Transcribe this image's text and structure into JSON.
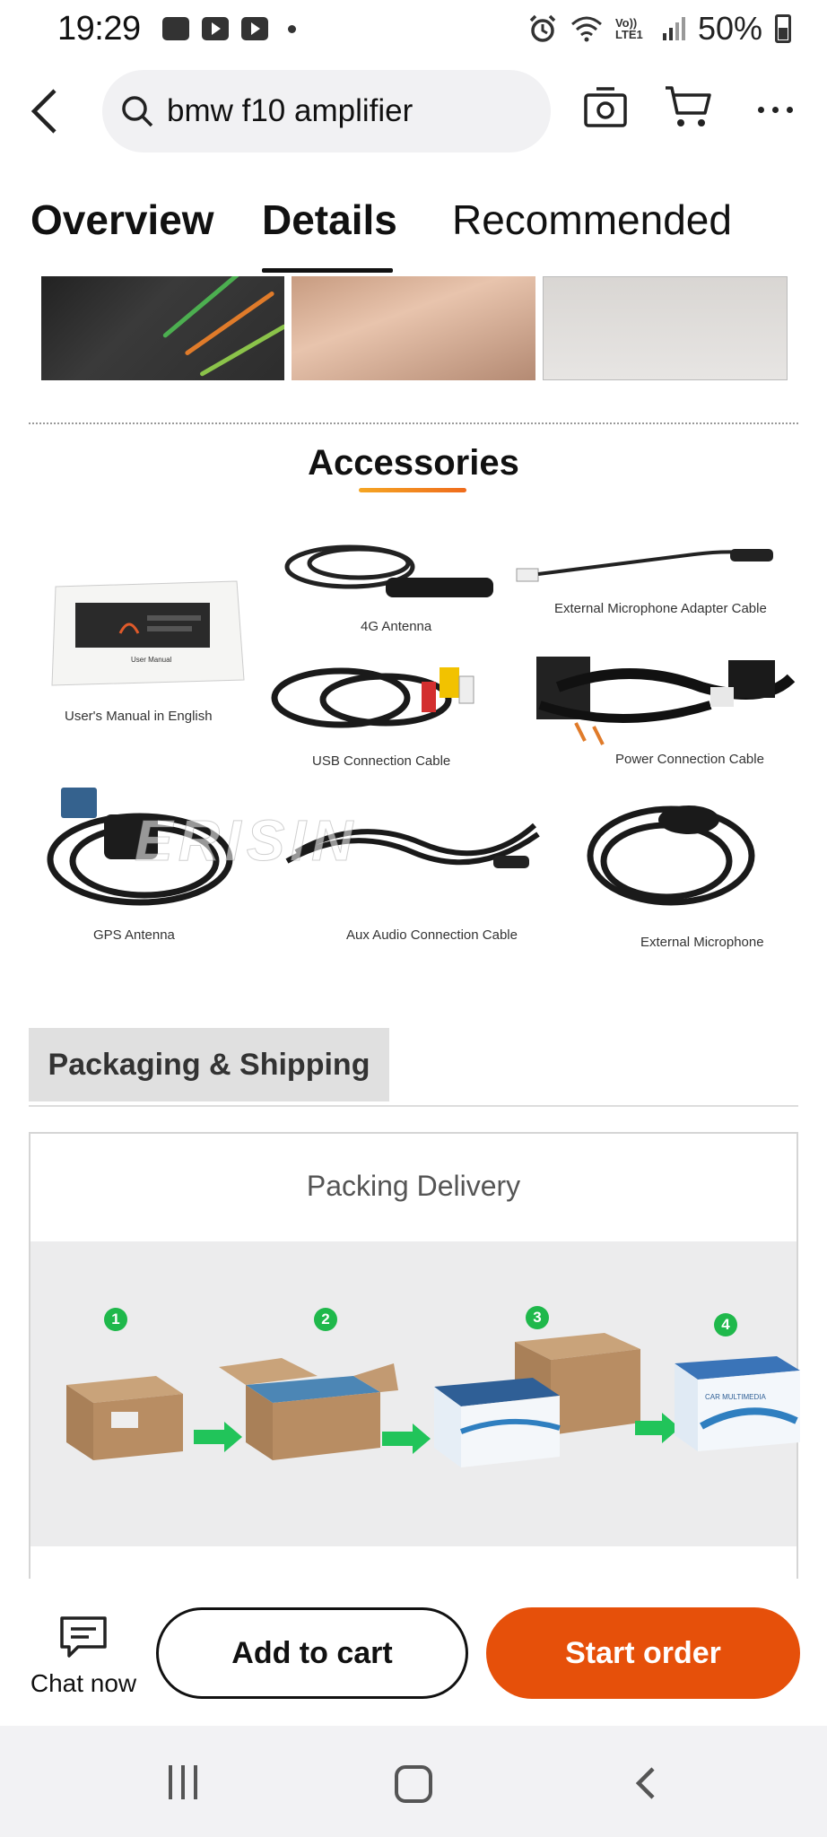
{
  "status_bar": {
    "time": "19:29",
    "network": "Vo)) LTE1",
    "battery": "50%"
  },
  "search": {
    "query": "bmw f10 amplifier"
  },
  "tabs": [
    {
      "label": "Overview"
    },
    {
      "label": "Details"
    },
    {
      "label": "Recommended"
    }
  ],
  "accessories": {
    "title": "Accessories",
    "items": [
      {
        "label": "User's Manual in English",
        "icon": "manual"
      },
      {
        "label": "4G Antenna",
        "icon": "antenna"
      },
      {
        "label": "External Microphone Adapter Cable",
        "icon": "cable"
      },
      {
        "label": "USB Connection Cable",
        "icon": "usb-cable"
      },
      {
        "label": "Power Connection Cable",
        "icon": "harness"
      },
      {
        "label": "GPS Antenna",
        "icon": "gps"
      },
      {
        "label": "Aux Audio Connection Cable",
        "icon": "aux-cable"
      },
      {
        "label": "External Microphone",
        "icon": "microphone"
      }
    ],
    "manual_caption": "User Manual"
  },
  "packaging": {
    "tab_label": "Packaging & Shipping",
    "card_title": "Packing Delivery",
    "steps": [
      "1",
      "2",
      "3",
      "4"
    ],
    "box_print": "CAR MULTIMEDIA"
  },
  "watermark": "ERISIN",
  "actions": {
    "chat_label": "Chat now",
    "add_to_cart": "Add to cart",
    "start_order": "Start order"
  },
  "colors": {
    "accent": "#e6500a",
    "step_green": "#1fb84b"
  }
}
